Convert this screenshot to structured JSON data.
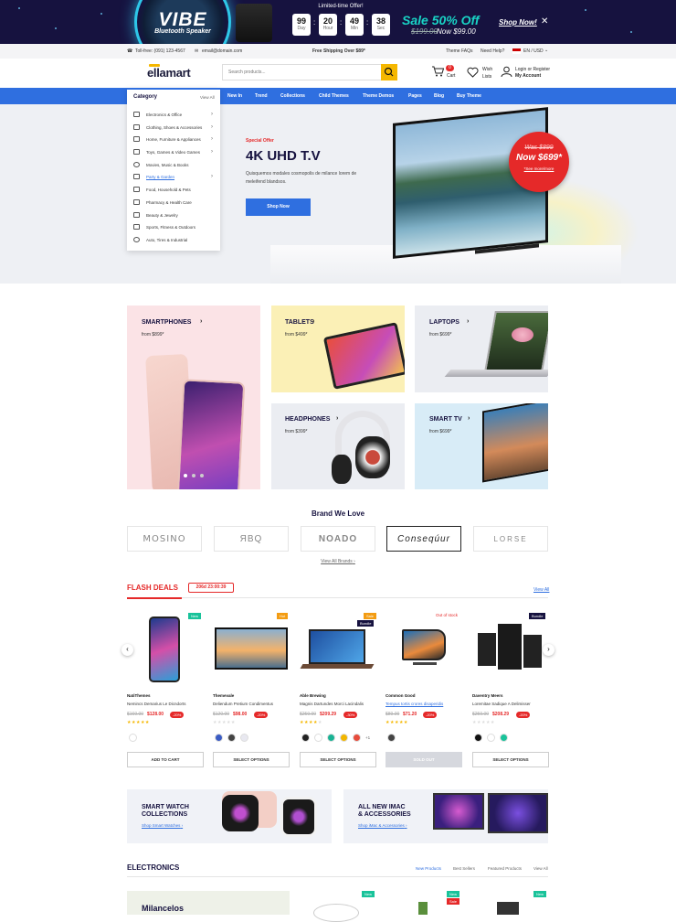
{
  "promo": {
    "brand_title": "VIBE",
    "brand_sub": "Bluetooth Speaker",
    "countdown_label": "Limited-time Offer!",
    "countdown": [
      {
        "v": "99",
        "u": "Day"
      },
      {
        "v": "20",
        "u": "Hour"
      },
      {
        "v": "49",
        "u": "Min"
      },
      {
        "v": "38",
        "u": "Sec"
      }
    ],
    "sale_title": "Sale 50% Off",
    "old_price": "$199.00",
    "new_price": "Now $99.00",
    "shop_now": "Shop Now!",
    "close": "✕"
  },
  "topbar": {
    "phone": "Toll-free: (091) 123-4567",
    "email": "email@domain.com",
    "shipping": "Free Shipping Over $89*",
    "faqs": "Theme FAQs",
    "help": "Need Help?",
    "lang": "EN / USD"
  },
  "header": {
    "logo": "ellamart",
    "search_placeholder": "Search products...",
    "cart_label": "Cart",
    "cart_count": "0",
    "wish_label": "Wish Lists",
    "account_line1": "Login or Register",
    "account_line2": "My Account"
  },
  "nav": {
    "category_label": "Category",
    "view_all": "View All",
    "items": [
      "New In",
      "Trend",
      "Collections",
      "Child Themes",
      "Theme Demos",
      "Pages",
      "Blog",
      "Buy Theme"
    ]
  },
  "categories": [
    "Electronics & Office",
    "Clothing, Shoes & Accessories",
    "Home, Furniture & Appliances",
    "Toys, Games & Video Games",
    "Movies, Music & Books",
    "Party & Garden",
    "Food, Household & Pets",
    "Pharmacy & Health Care",
    "Beauty & Jewelry",
    "Sports, Fitness & Outdoors",
    "Auto, Tires & Industrial"
  ],
  "hero": {
    "special": "Special Offer",
    "title": "4K UHD T.V",
    "desc": "Quisquemos modales cosmopolis de milance lorem de meleifend blandsos.",
    "button": "Shop Now",
    "was": "Was $899",
    "now": "Now $699*",
    "see_more": "*See more/more"
  },
  "collections": [
    {
      "title": "SMARTPHONES",
      "price": "from $899*"
    },
    {
      "title": "TABLETS",
      "price": "from $499*"
    },
    {
      "title": "LAPTOPS",
      "price": "from $699*"
    },
    {
      "title": "HEADPHONES",
      "price": "from $399*"
    },
    {
      "title": "SMART TV",
      "price": "from $699*"
    }
  ],
  "brands": {
    "title": "Brand We Love",
    "items": [
      "MOSINO",
      "ЯBQ",
      "NOADO",
      "Conseqúur",
      "LORSE"
    ],
    "view_all": "View All Brands"
  },
  "flash": {
    "title": "FLASH DEALS",
    "timer": "206d 23:00:39",
    "view_all": "View All",
    "products": [
      {
        "tag": "New",
        "vendor": "NatiThemes",
        "name": "Nemincs Demarius Le Dicndorts",
        "old": "$169.00",
        "new": "$128.00",
        "disc": "-20%",
        "button": "ADD TO CART",
        "swatches": [
          "#ffffff"
        ]
      },
      {
        "tag": "Hot",
        "vendor": "Themevale",
        "name": "Deliendum Pretium Condimentus",
        "old": "$120.00",
        "new": "$98.00",
        "disc": "-20%",
        "button": "SELECT OPTIONS",
        "swatches": [
          "#3b5cc4",
          "#444444",
          "#e8e8f0"
        ]
      },
      {
        "tag": "Sale",
        "tag2": "Bundle",
        "vendor": "Able Brewing",
        "name": "Magnis Dartundes Morci Lacindalis",
        "old": "$259.00",
        "new": "$209.29",
        "disc": "-30%",
        "button": "SELECT OPTIONS",
        "swatches": [
          "#222222",
          "#ffffff",
          "#19b394",
          "#f2b600",
          "#e74c3c"
        ],
        "more": "+1"
      },
      {
        "tag": "Out of stock",
        "vendor": "Common Good",
        "name": "Tempus tortis crores disaperidis",
        "old": "$89.00",
        "new": "$71.20",
        "disc": "-20%",
        "button": "SOLD OUT",
        "swatches": [
          "#444444"
        ]
      },
      {
        "tag": "Bundle",
        "vendor": "Daventry Meers",
        "name": "Loremitae Sadique A Delimisser",
        "old": "$259.00",
        "new": "$208.29",
        "disc": "-20%",
        "button": "SELECT OPTIONS",
        "swatches": [
          "#111111",
          "#ffffff",
          "#19c39a"
        ]
      }
    ]
  },
  "banners": [
    {
      "title1": "SMART WATCH",
      "title2": "COLLECTIONS",
      "link": "Shop Smart Watches"
    },
    {
      "title1": "ALL NEW IMAC",
      "title2": "& ACCESSORIES",
      "link": "Shop iMac & Accessories"
    }
  ],
  "electronics": {
    "title": "ELECTRONICS",
    "tabs": [
      "New Products",
      "Best Sellers",
      "Featured Products",
      "View All"
    ],
    "feature": "Milancelos",
    "tags": [
      "New",
      "New",
      "Sale",
      "New"
    ]
  },
  "colors": {
    "accent": "#2f6fe0",
    "sale": "#e52929",
    "navy": "#16123f",
    "teal": "#19d3c5",
    "gold": "#f5b700"
  }
}
